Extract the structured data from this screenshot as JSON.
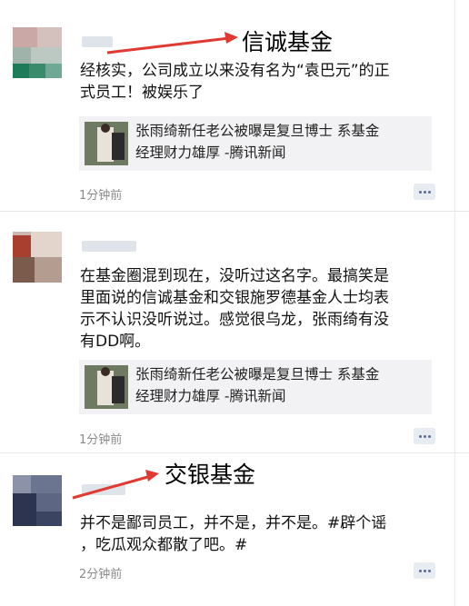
{
  "posts": [
    {
      "text": "经核实，公司成立以来没有名为“袁巴元”的正\n式员工！被娱乐了",
      "link": {
        "title": "张雨绮新任老公被曝是复旦博士 系基金\n经理财力雄厚 -腾讯新闻"
      },
      "time": "1分钟前"
    },
    {
      "text": "在基金圈混到现在，没听过这名字。最搞笑是\n里面说的信诚基金和交银施罗德基金人士均表\n示不认识没听说过。感觉很乌龙，张雨绮有没\n有DD啊。",
      "link": {
        "title": "张雨绮新任老公被曝是复旦博士 系基金\n经理财力雄厚 -腾讯新闻"
      },
      "time": "1分钟前"
    },
    {
      "text": "并不是鄙司员工，并不是，并不是。#辟个谣\n，吃瓜观众都散了吧。#",
      "time": "2分钟前"
    }
  ],
  "annotations": [
    {
      "label": "信诚基金",
      "color": "#e03a32"
    },
    {
      "label": "交银基金",
      "color": "#e03a32"
    }
  ],
  "icons": {
    "comment": "comment-icon"
  }
}
